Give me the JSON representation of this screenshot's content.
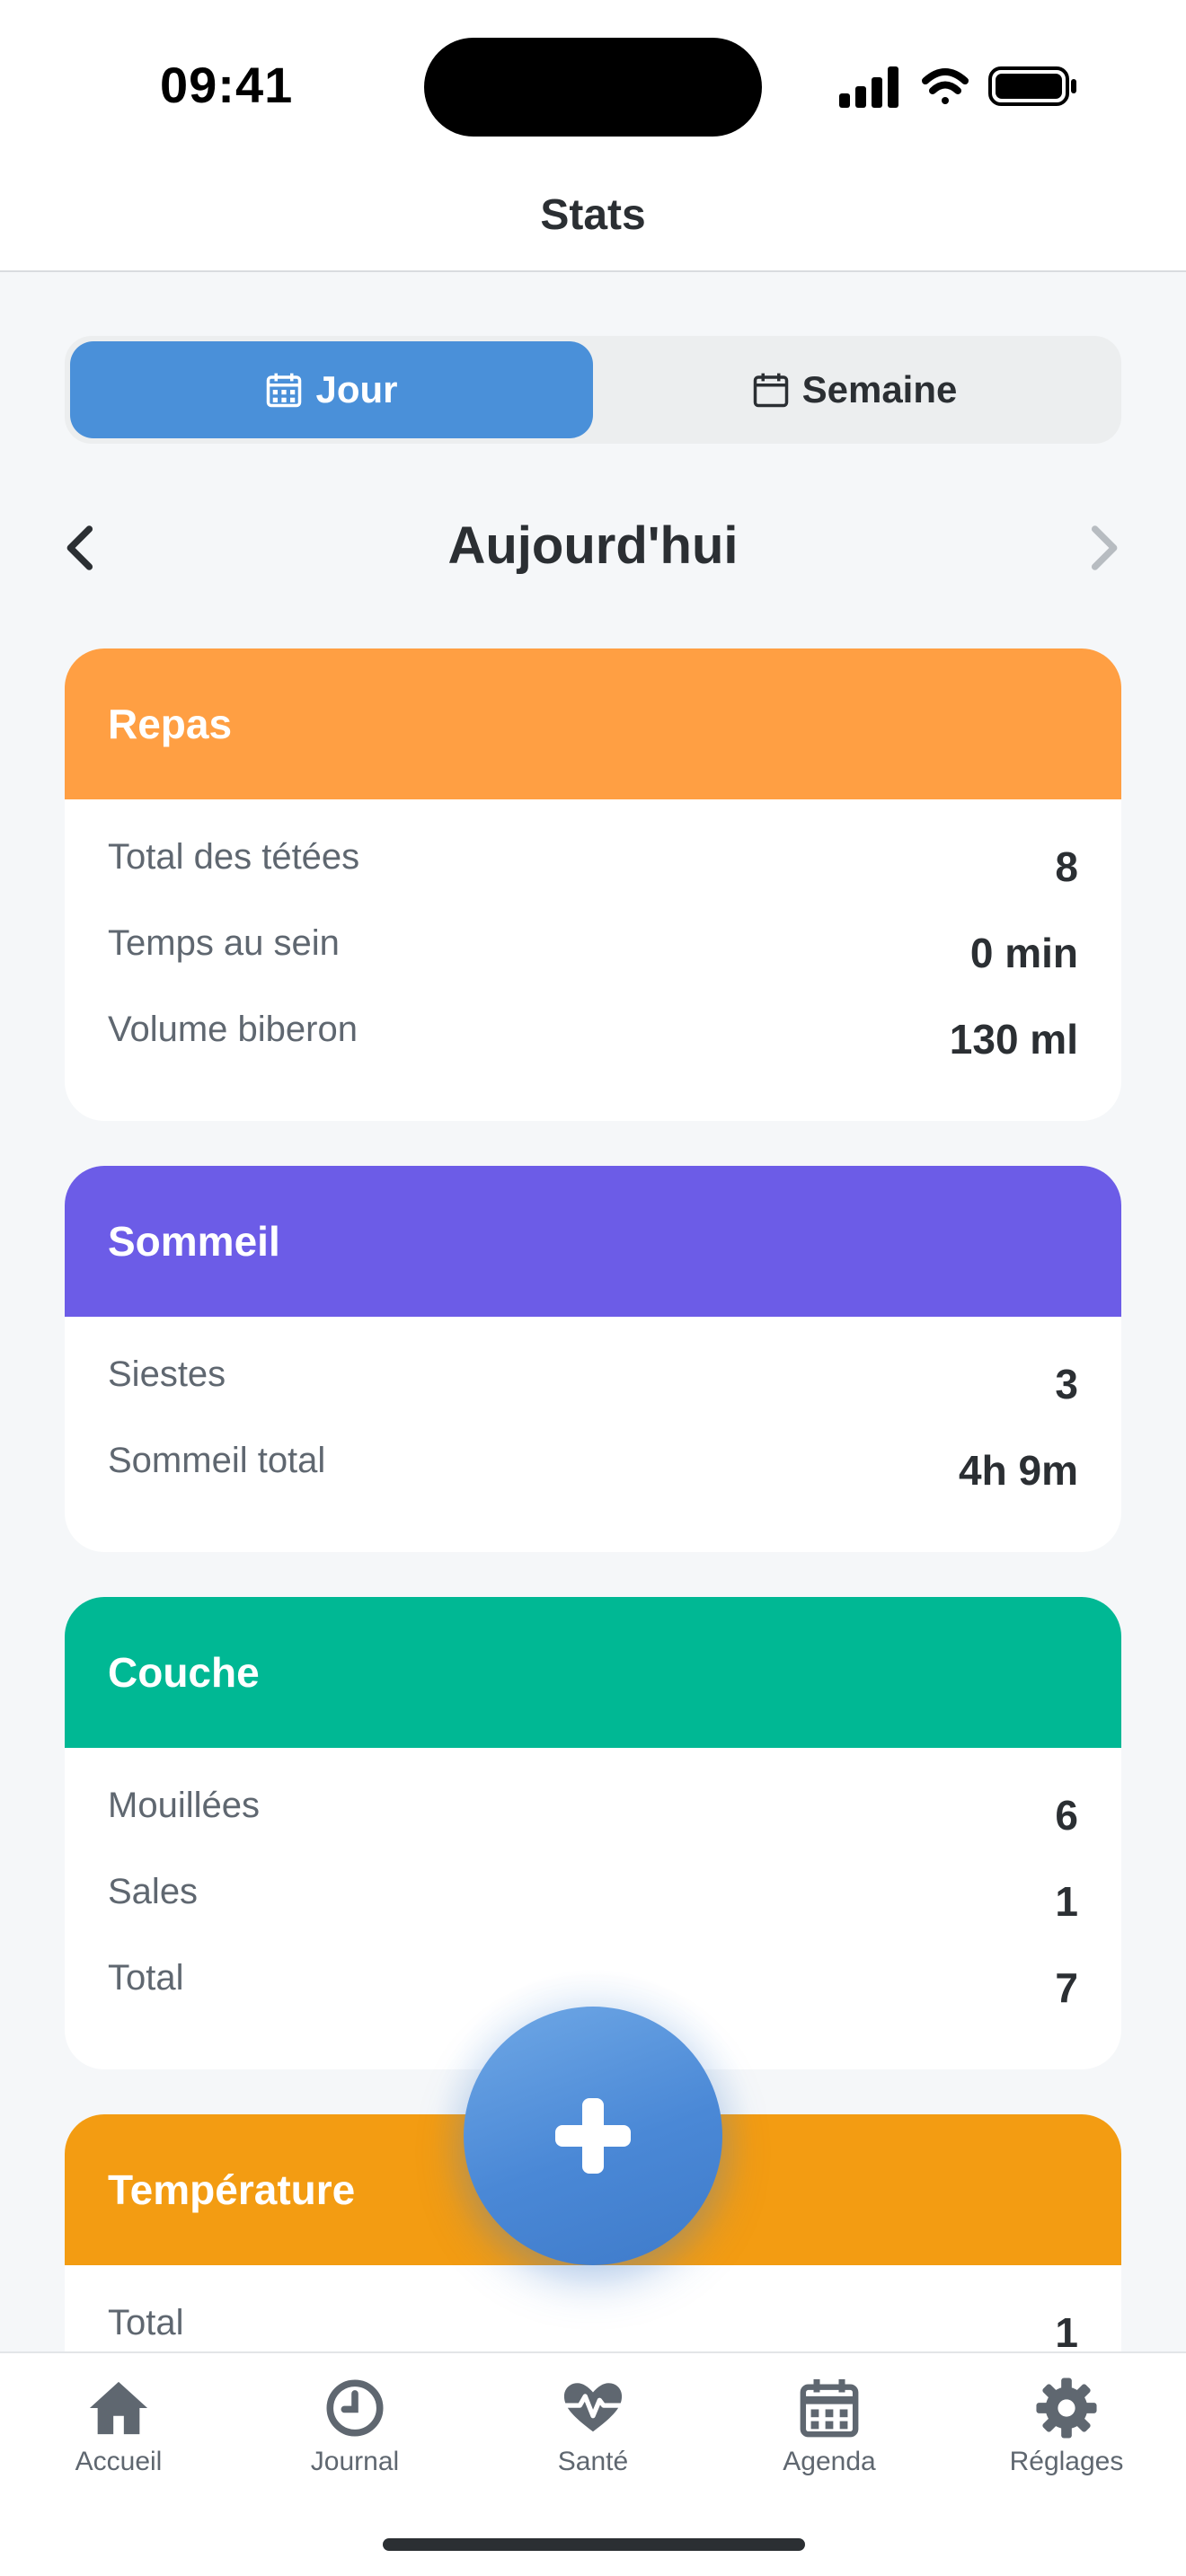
{
  "status_bar": {
    "time": "09:41"
  },
  "nav": {
    "title": "Stats"
  },
  "segments": {
    "day": "Jour",
    "week": "Semaine",
    "selected": "day"
  },
  "date_nav": {
    "label": "Aujourd'hui"
  },
  "colors": {
    "accent": "#4a90d9",
    "repas": "#ff9f43",
    "sommeil": "#6c5ce7",
    "couche": "#00b894",
    "temperature": "#f39c12"
  },
  "cards": {
    "repas": {
      "title": "Repas",
      "rows": [
        {
          "label": "Total des tétées",
          "value": "8"
        },
        {
          "label": "Temps au sein",
          "value": "0 min"
        },
        {
          "label": "Volume biberon",
          "value": "130 ml"
        }
      ]
    },
    "sommeil": {
      "title": "Sommeil",
      "rows": [
        {
          "label": "Siestes",
          "value": "3"
        },
        {
          "label": "Sommeil total",
          "value": "4h 9m"
        }
      ]
    },
    "couche": {
      "title": "Couche",
      "rows": [
        {
          "label": "Mouillées",
          "value": "6"
        },
        {
          "label": "Sales",
          "value": "1"
        },
        {
          "label": "Total",
          "value": "7"
        }
      ]
    },
    "temperature": {
      "title": "Température",
      "rows": [
        {
          "label": "Total",
          "value": "1"
        }
      ]
    }
  },
  "fab": {
    "icon": "plus-icon"
  },
  "tabbar": {
    "items": [
      {
        "label": "Accueil",
        "icon": "home-icon"
      },
      {
        "label": "Journal",
        "icon": "clock-icon"
      },
      {
        "label": "Santé",
        "icon": "heart-pulse-icon"
      },
      {
        "label": "Agenda",
        "icon": "calendar-icon"
      },
      {
        "label": "Réglages",
        "icon": "gear-icon"
      }
    ]
  }
}
